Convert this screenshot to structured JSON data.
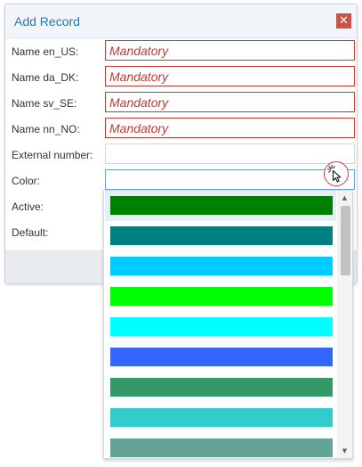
{
  "dialog": {
    "title": "Add Record",
    "close_glyph": "✕"
  },
  "fields": {
    "name_en_us": {
      "label": "Name en_US:",
      "placeholder": "Mandatory"
    },
    "name_da_dk": {
      "label": "Name da_DK:",
      "placeholder": "Mandatory"
    },
    "name_sv_se": {
      "label": "Name sv_SE:",
      "placeholder": "Mandatory"
    },
    "name_nn_no": {
      "label": "Name nn_NO:",
      "placeholder": "Mandatory"
    },
    "external_number": {
      "label": "External number:",
      "value": ""
    },
    "color": {
      "label": "Color:",
      "value": ""
    },
    "active": {
      "label": "Active:"
    },
    "default": {
      "label": "Default:"
    }
  },
  "color_picker": {
    "icon": "color-picker-icon",
    "swatches": [
      "#008000",
      "#008080",
      "#00ccff",
      "#00ff00",
      "#00ffff",
      "#3366ff",
      "#339966",
      "#33cccc",
      "#66a397"
    ],
    "scroll_up_glyph": "▲",
    "scroll_down_glyph": "▼"
  },
  "colors": {
    "accent": "#2a74b8",
    "mandatory": "#c23a32",
    "close": "#c9554a"
  }
}
